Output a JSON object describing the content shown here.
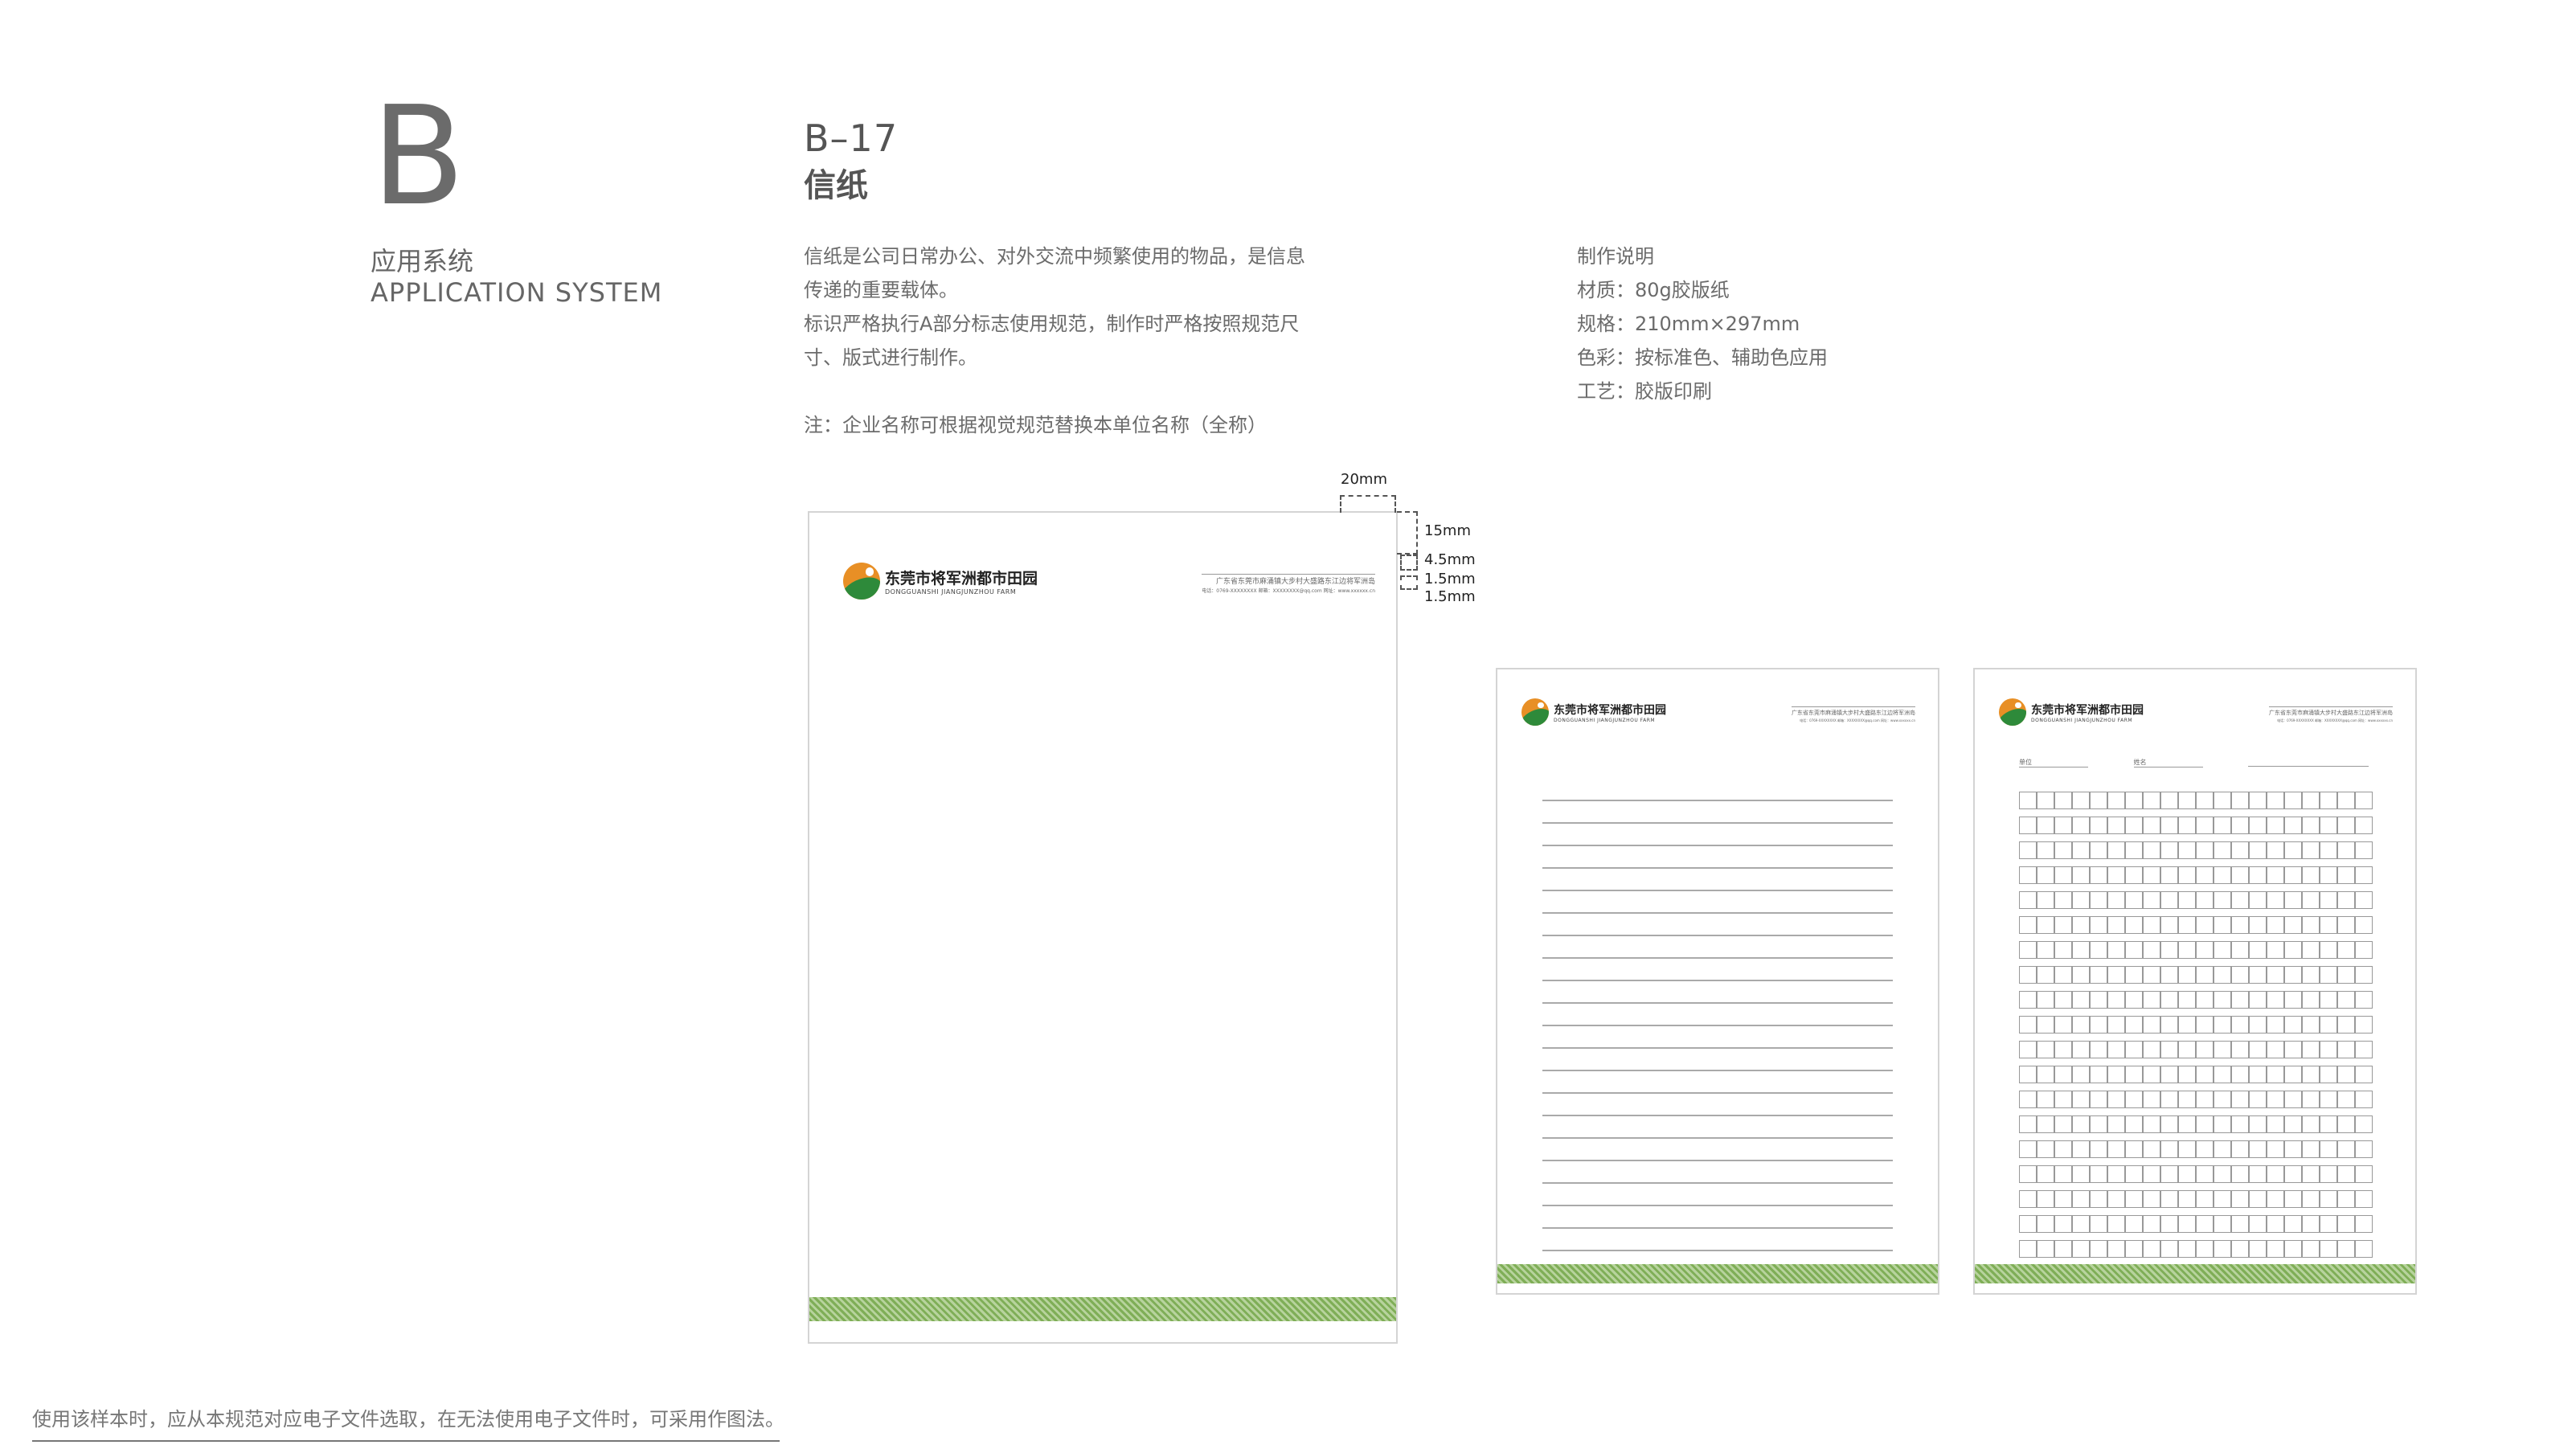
{
  "section": {
    "letter": "B",
    "name_cn": "应用系统",
    "name_en": "APPLICATION SYSTEM"
  },
  "page": {
    "code": "B–17",
    "title": "信纸"
  },
  "description": {
    "lines": [
      "信纸是公司日常办公、对外交流中频繁使用的物品，是信息",
      "传递的重要载体。",
      "标识严格执行A部分标志使用规范，制作时严格按照规范尺",
      "寸、版式进行制作。"
    ],
    "note": "注：企业名称可根据视觉规范替换本单位名称（全称）"
  },
  "spec": {
    "heading": "制作说明",
    "material": "材质：80g胶版纸",
    "size": "规格：210mm×297mm",
    "color": "色彩：按标准色、辅助色应用",
    "process": "工艺：胶版印刷"
  },
  "brand": {
    "name_cn": "东莞市将军洲都市田园",
    "name_en": "DONGGUANSHI JIANGJUNZHOU FARM",
    "address": "广东省东莞市麻涌镇大步村大盛路东江边将军洲岛",
    "contact": "电话：0769-XXXXXXXX    邮箱：XXXXXXXX@qq.com    网址：www.xxxxxx.cn",
    "colors": {
      "orange": "#e88f25",
      "green": "#2e8a3a",
      "band_green": "#8fbc6b"
    }
  },
  "dimensions": {
    "right_margin": "20mm",
    "top": "15mm",
    "block": "4.5mm",
    "gap1": "1.5mm",
    "gap2": "1.5mm"
  },
  "grid_sheet": {
    "field1": "单位",
    "field2": "姓名",
    "rows": 19,
    "cols": 20
  },
  "lined_sheet": {
    "rows": 22
  },
  "footer": {
    "note": "使用该样本时，应从本规范对应电子文件选取，在无法使用电子文件时，可采用作图法。"
  }
}
